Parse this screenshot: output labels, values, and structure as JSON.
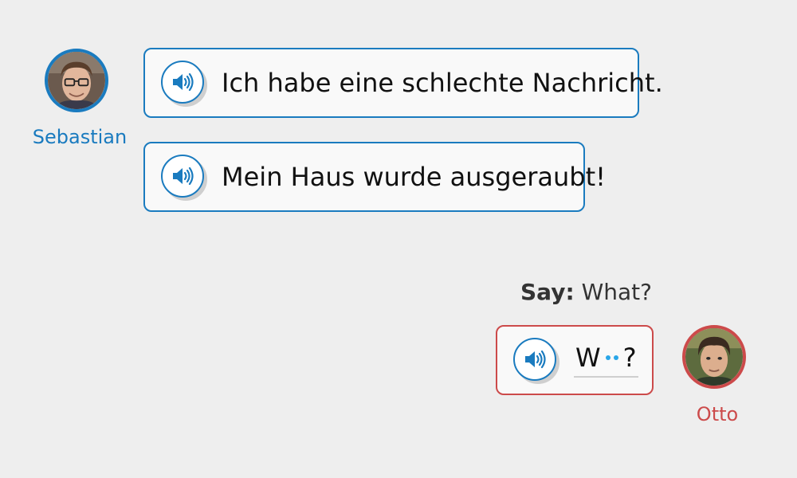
{
  "colors": {
    "background": "#eeeeee",
    "speaker_a": "#1a7bbf",
    "speaker_b": "#cc4a4a",
    "blank_dot": "#29a6e8"
  },
  "speakers": {
    "a": {
      "name": "Sebastian"
    },
    "b": {
      "name": "Otto"
    }
  },
  "messages": [
    {
      "speaker": "Sebastian",
      "text": "Ich habe eine schlechte Nachricht."
    },
    {
      "speaker": "Sebastian",
      "text": "Mein Haus wurde ausgeraubt!"
    }
  ],
  "prompt": {
    "label": "Say:",
    "text": "What?"
  },
  "response": {
    "prefix": "W",
    "suffix": "?",
    "blank_count": 2
  },
  "icons": {
    "audio": "speaker-icon"
  }
}
